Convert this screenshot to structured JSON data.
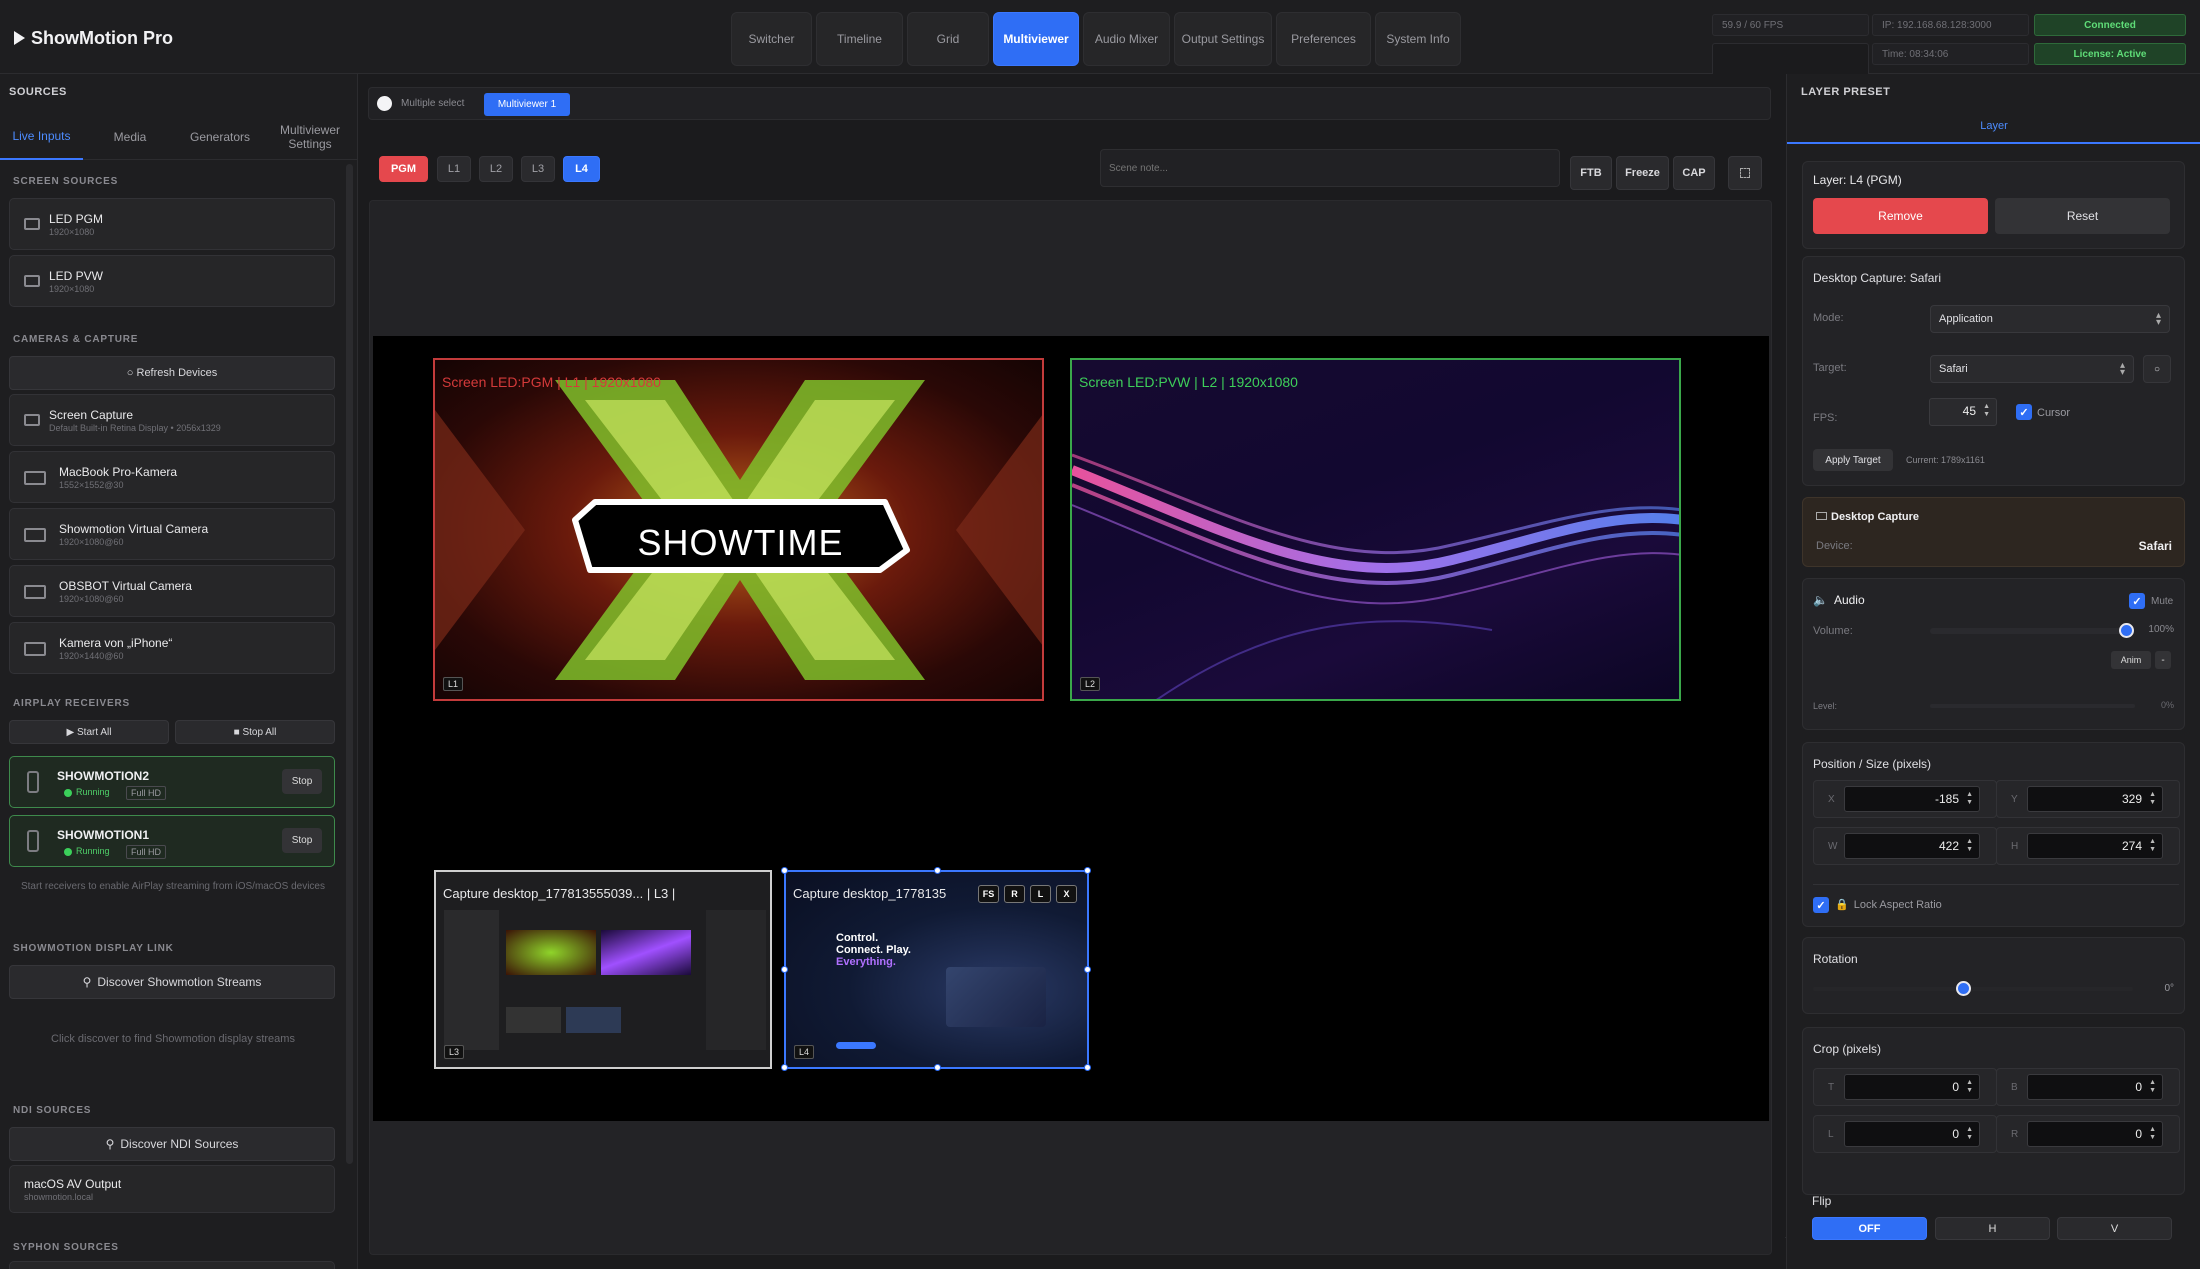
{
  "app": {
    "title": "ShowMotion Pro"
  },
  "nav": {
    "tabs": [
      {
        "label": "Switcher"
      },
      {
        "label": "Timeline"
      },
      {
        "label": "Grid"
      },
      {
        "label": "Multiviewer"
      },
      {
        "label": "Audio Mixer"
      },
      {
        "label": "Output Settings"
      },
      {
        "label": "Preferences"
      },
      {
        "label": "System Info"
      }
    ],
    "active": "Multiviewer"
  },
  "status": {
    "fps": "59.9 / 60 FPS",
    "ip": "IP: 192.168.68.128:3000",
    "connection": "Connected",
    "blank": "--",
    "time": "Time: 08:34:06",
    "license": "License: Active"
  },
  "sources": {
    "title": "SOURCES",
    "tabs": [
      "Live Inputs",
      "Media",
      "Generators",
      "Multiviewer Settings"
    ],
    "screen_group": "SCREEN SOURCES",
    "screens": [
      {
        "name": "LED PGM",
        "res": "1920×1080",
        "icon": "monitor-icon"
      },
      {
        "name": "LED PVW",
        "res": "1920×1080",
        "icon": "monitor-icon"
      }
    ],
    "cam_group": "CAMERAS & CAPTURE",
    "refresh": "○ Refresh Devices",
    "cameras": [
      {
        "name": "Screen Capture",
        "res": "Default Built-in Retina Display • 2056x1329",
        "icon": "monitor-icon"
      },
      {
        "name": "MacBook Pro-Kamera",
        "res": "1552×1552@30",
        "icon": "camera-icon"
      },
      {
        "name": "Showmotion Virtual Camera",
        "res": "1920×1080@60",
        "icon": "camera-icon"
      },
      {
        "name": "OBSBOT Virtual Camera",
        "res": "1920×1080@60",
        "icon": "camera-icon"
      },
      {
        "name": "Kamera von „iPhone“",
        "res": "1920×1440@60",
        "icon": "camera-icon"
      }
    ],
    "airplay_group": "AIRPLAY RECEIVERS",
    "start_all": "▶ Start All",
    "stop_all": "■ Stop All",
    "receivers": [
      {
        "name": "SHOWMOTION2",
        "status": "Running",
        "quality": "Full HD",
        "action": "Stop"
      },
      {
        "name": "SHOWMOTION1",
        "status": "Running",
        "quality": "Full HD",
        "action": "Stop"
      }
    ],
    "airplay_hint": "Start receivers to enable AirPlay streaming from iOS/macOS devices",
    "link_group": "SHOWMOTION DISPLAY LINK",
    "discover_streams": "Discover Showmotion Streams",
    "link_hint": "Click discover to find Showmotion display streams",
    "ndi_group": "NDI SOURCES",
    "discover_ndi": "Discover NDI Sources",
    "ndi_items": [
      {
        "name": "macOS AV Output",
        "sub": "showmotion.local"
      }
    ],
    "syphon_group": "SYPHON SOURCES"
  },
  "multiviewer": {
    "multiple_select": "Multiple select",
    "active_view": "Multiviewer 1",
    "layer_tabs": [
      "PGM",
      "L1",
      "L2",
      "L3",
      "L4"
    ],
    "selected_layer": "L4",
    "scene_note_placeholder": "Scene note...",
    "buttons": {
      "ftb": "FTB",
      "freeze": "Freeze",
      "cap": "CAP"
    },
    "tiles": [
      {
        "caption": "Screen LED:PGM | L1 | 1920x1080",
        "tag": "L1",
        "graphic_text": "SHOWTIME"
      },
      {
        "caption": "Screen LED:PVW | L2 | 1920x1080",
        "tag": "L2"
      },
      {
        "caption": "Capture desktop_177813555039... | L3 |",
        "tag": "L3"
      },
      {
        "caption": "Capture desktop_1778135",
        "tag": "L4",
        "tools": [
          "FS",
          "R",
          "L",
          "X"
        ],
        "preview_text": [
          "Control.",
          "Connect. Play.",
          "Everything."
        ]
      }
    ]
  },
  "layer_preset": {
    "title": "LAYER PRESET",
    "tab": "Layer",
    "layer_label": "Layer: L4 (PGM)",
    "remove": "Remove",
    "reset": "Reset",
    "capture_title": "Desktop Capture: Safari",
    "mode_label": "Mode:",
    "mode": "Application",
    "target_label": "Target:",
    "target": "Safari",
    "fps_label": "FPS:",
    "fps": "45",
    "cursor": "Cursor",
    "apply": "Apply Target",
    "current": "Current: 1789x1161",
    "device_card_title": "Desktop Capture",
    "device_label": "Device:",
    "device": "Safari",
    "audio_title": "Audio",
    "mute": "Mute",
    "volume_label": "Volume:",
    "volume": "100%",
    "volume_level": 1.0,
    "anim": "Anim",
    "minus": "-",
    "level_label": "Level:",
    "level": "0%",
    "pos_title": "Position / Size (pixels)",
    "x": "-185",
    "y": "329",
    "w": "422",
    "h": "274",
    "lock": "Lock Aspect Ratio",
    "rotation_title": "Rotation",
    "rotation": "0°",
    "crop_title": "Crop (pixels)",
    "crop_t": "0",
    "crop_b": "0",
    "crop_l": "0",
    "crop_r": "0",
    "flip_title": "Flip",
    "flip": [
      "OFF",
      "H",
      "V"
    ]
  },
  "colors": {
    "accent": "#2f6ef5",
    "danger": "#e5484d",
    "success": "#3bd05a"
  }
}
